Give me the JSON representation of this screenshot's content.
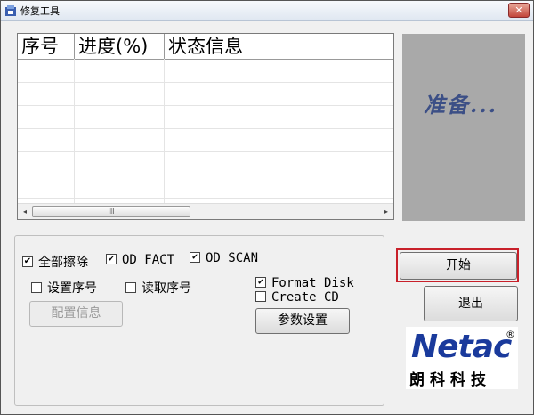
{
  "window": {
    "title": "修复工具",
    "close_label": "✕"
  },
  "list": {
    "columns": [
      "序号",
      "进度(%)",
      "状态信息"
    ],
    "scroll_grip": "III",
    "scroll_left": "◂",
    "scroll_right": "▸"
  },
  "status": {
    "text": "准备..."
  },
  "options": {
    "erase_all": {
      "label": "全部擦除",
      "checked": true
    },
    "od_fact": {
      "label": "OD FACT",
      "checked": true
    },
    "od_scan": {
      "label": "OD SCAN",
      "checked": true
    },
    "set_serial": {
      "label": "设置序号",
      "checked": false
    },
    "read_serial": {
      "label": "读取序号",
      "checked": false
    },
    "format_disk": {
      "label": "Format Disk",
      "checked": true
    },
    "create_cd": {
      "label": "Create CD",
      "checked": false
    },
    "config_info_label": "配置信息",
    "params_label": "参数设置"
  },
  "actions": {
    "start_label": "开始",
    "exit_label": "退出"
  },
  "logo": {
    "main": "Netac",
    "sub": "朗科科技",
    "reg": "®"
  },
  "colors": {
    "status_text": "#3c4f86",
    "highlight": "#c8202a",
    "logo_blue": "#1a3a9c"
  }
}
